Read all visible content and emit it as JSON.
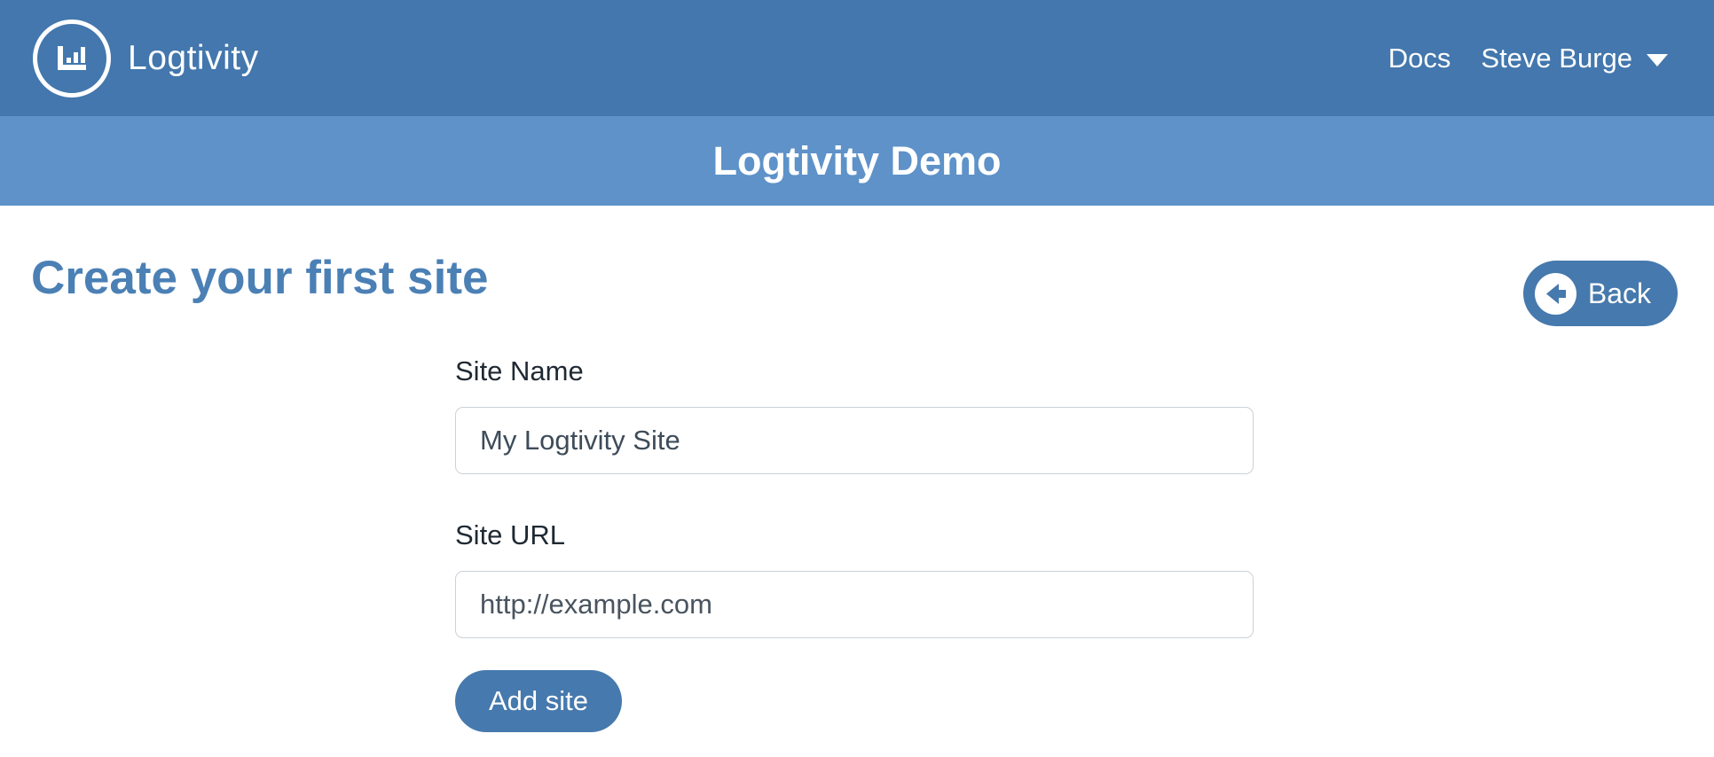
{
  "colors": {
    "navbar_bg": "#4377ad",
    "banner_bg": "#5e92c9",
    "heading_text": "#4b80b5",
    "button_bg": "#4679ad",
    "button_text": "#ffffff",
    "input_border": "#cbd2d9",
    "label_text": "#1f2933",
    "input_text": "#3e4c59"
  },
  "navbar": {
    "brand": "Logtivity",
    "logo_icon": "bar-chart-in-circle",
    "docs_label": "Docs",
    "user_name": "Steve Burge",
    "user_caret_icon": "chevron-down"
  },
  "banner": {
    "title": "Logtivity Demo"
  },
  "main": {
    "heading": "Create your first site",
    "back_button": {
      "label": "Back",
      "icon": "arrow-left-circle"
    },
    "form": {
      "site_name_label": "Site Name",
      "site_name_value": "My Logtivity Site",
      "site_url_label": "Site URL",
      "site_url_placeholder": "http://example.com",
      "submit_label": "Add site"
    }
  }
}
